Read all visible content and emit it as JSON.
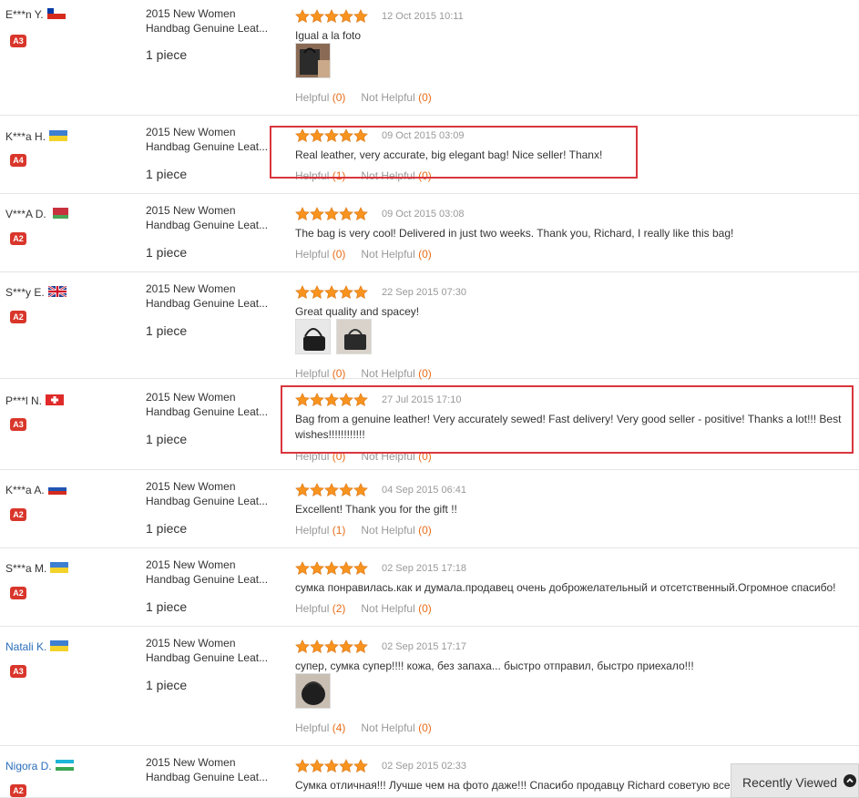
{
  "product_title_line1": "2015 New Women",
  "product_title_line2": "Handbag Genuine Leat...",
  "colors": {
    "star": "#f7931e",
    "badge_red": "#d9362b",
    "highlight": "#d9363e",
    "helpful_count": "#e96d1a"
  },
  "reviews": [
    {
      "buyer": "E***n Y.",
      "flag": "cl",
      "badge": "A3",
      "qty": "1 piece",
      "date": "12 Oct 2015 10:11",
      "text": "Igual a la foto",
      "photos": 1,
      "helpful_label": "Helpful",
      "helpful": "(0)",
      "not_helpful_label": "Not Helpful",
      "not_helpful": "(0)"
    },
    {
      "buyer": "K***a H.",
      "flag": "ua",
      "badge": "A4",
      "qty": "1 piece",
      "date": "09 Oct 2015 03:09",
      "text": "Real leather, very accurate, big elegant bag! Nice seller! Thanx!",
      "photos": 0,
      "helpful_label": "Helpful",
      "helpful": "(1)",
      "not_helpful_label": "Not Helpful",
      "not_helpful": "(0)"
    },
    {
      "buyer": "V***A D.",
      "flag": "by",
      "badge": "A2",
      "qty": "1 piece",
      "date": "09 Oct 2015 03:08",
      "text": "The bag is very cool! Delivered in just two weeks. Thank you, Richard, I really like this bag!",
      "photos": 0,
      "helpful_label": "Helpful",
      "helpful": "(0)",
      "not_helpful_label": "Not Helpful",
      "not_helpful": "(0)"
    },
    {
      "buyer": "S***y E.",
      "flag": "gb",
      "badge": "A2",
      "qty": "1 piece",
      "date": "22 Sep 2015 07:30",
      "text": "Great quality and spacey!",
      "photos": 2,
      "helpful_label": "Helpful",
      "helpful": "(0)",
      "not_helpful_label": "Not Helpful",
      "not_helpful": "(0)"
    },
    {
      "buyer": "P***l N.",
      "flag": "ch",
      "badge": "A3",
      "qty": "1 piece",
      "date": "27 Jul 2015 17:10",
      "text": "Bag from a genuine leather! Very accurately sewed! Fast delivery! Very good seller - positive! Thanks a lot!!! Best wishes!!!!!!!!!!!!",
      "photos": 0,
      "helpful_label": "Helpful",
      "helpful": "(0)",
      "not_helpful_label": "Not Helpful",
      "not_helpful": "(0)"
    },
    {
      "buyer": "K***a A.",
      "flag": "ru",
      "badge": "A2",
      "qty": "1 piece",
      "date": "04 Sep 2015 06:41",
      "text": "Excellent! Thank you for the gift !!",
      "photos": 0,
      "helpful_label": "Helpful",
      "helpful": "(1)",
      "not_helpful_label": "Not Helpful",
      "not_helpful": "(0)"
    },
    {
      "buyer": "S***a M.",
      "flag": "ua",
      "badge": "A2",
      "qty": "1 piece",
      "date": "02 Sep 2015 17:18",
      "text": "сумка понравилась.как и думала.продавец очень доброжелательный и отсетственный.Огромное спасибо!",
      "photos": 0,
      "helpful_label": "Helpful",
      "helpful": "(2)",
      "not_helpful_label": "Not Helpful",
      "not_helpful": "(0)"
    },
    {
      "buyer": "Natali K.",
      "flag": "ua",
      "badge": "A3",
      "qty": "1 piece",
      "date": "02 Sep 2015 17:17",
      "text": "супер, сумка супер!!!! кожа, без запаха... быстро отправил, быстро приехало!!!",
      "photos": 1,
      "helpful_label": "Helpful",
      "helpful": "(4)",
      "not_helpful_label": "Not Helpful",
      "not_helpful": "(0)"
    },
    {
      "buyer": "Nigora D.",
      "flag": "uz",
      "badge": "A2",
      "qty": "",
      "date": "02 Sep 2015 02:33",
      "text": "Сумка отличная!!! Лучше чем на фото даже!!! Спасибо продавцу Richard советую всем",
      "photos": 0,
      "helpful_label": "",
      "helpful": "",
      "not_helpful_label": "",
      "not_helpful": ""
    }
  ],
  "recently_viewed": {
    "label": "Recently Viewed"
  }
}
